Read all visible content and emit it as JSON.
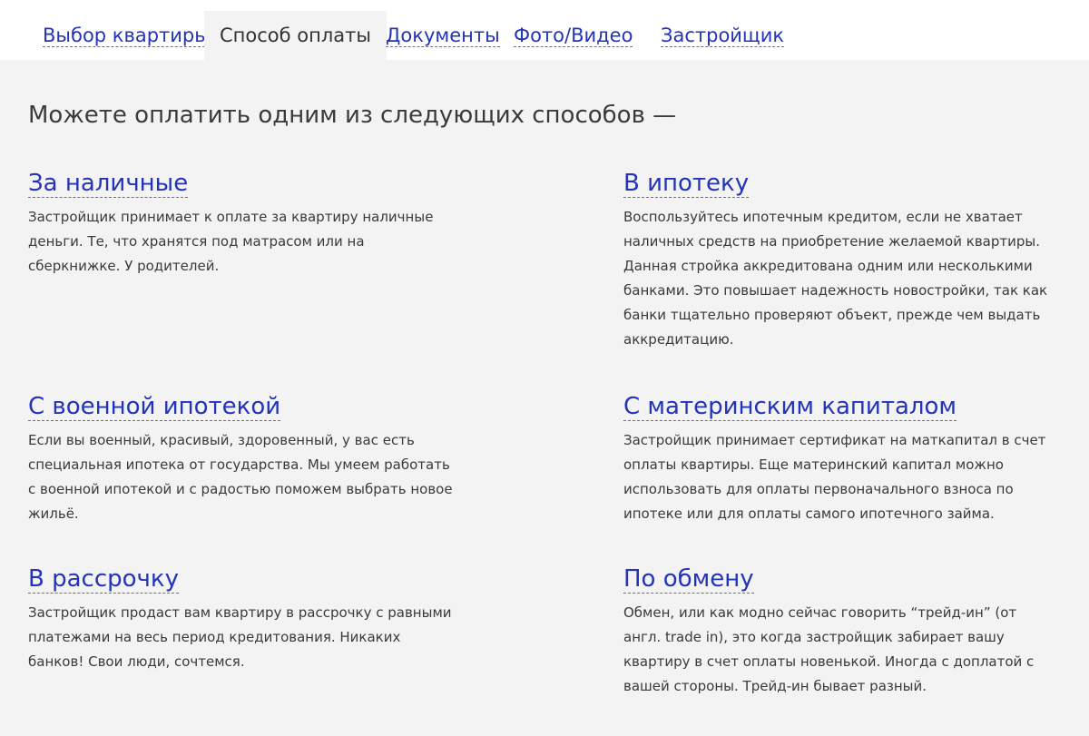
{
  "tabs": [
    {
      "label": "Выбор квартиры",
      "active": false
    },
    {
      "label": "Способ оплаты",
      "active": true
    },
    {
      "label": "Документы",
      "active": false
    },
    {
      "label": "Фото/Видео",
      "active": false
    },
    {
      "label": "Застройщик",
      "active": false
    }
  ],
  "headline": "Можете оплатить одним из следующих способов —",
  "methods": [
    {
      "title": "За наличные",
      "description": "Застройщик принимает к оплате за квартиру наличные деньги. Те, что хранятся под матрасом или на сберкнижке. У родителей."
    },
    {
      "title": "В ипотеку",
      "description": "Воспользуйтесь ипотечным кредитом, если не хватает наличных средств на приобретение желаемой квартиры. Данная стройка аккредитована одним или несколькими банками. Это повышает надежность новостройки, так как банки тщательно проверяют объект, прежде чем выдать аккредитацию."
    },
    {
      "title": "С военной ипотекой",
      "description": "Если вы военный, красивый, здоровенный, у вас есть специальная ипотека от государства. Мы умеем работать с военной ипотекой и с радостью поможем выбрать новое жильё."
    },
    {
      "title": "С материнским капиталом",
      "description": "Застройщик принимает сертификат на маткапитал в счет оплаты квартиры. Еще материнский капитал можно использовать для оплаты первоначального взноса по ипотеке или для оплаты самого ипотечного займа."
    },
    {
      "title": "В рассрочку",
      "description": "Застройщик продаст вам квартиру в рассрочку с равными платежами на весь период кредитования. Никаких банков! Свои люди, сочтемся."
    },
    {
      "title": "По обмену",
      "description": "Обмен, или как модно сейчас говорить “трейд-ин” (от англ. trade in), это когда застройщик забирает вашу квартиру в счет оплаты новенькой. Иногда с доплатой с вашей стороны. Трейд-ин бывает разный."
    }
  ],
  "colors": {
    "link": "#2334b8",
    "text": "#3a3a3a",
    "background": "#f3f3f3"
  }
}
